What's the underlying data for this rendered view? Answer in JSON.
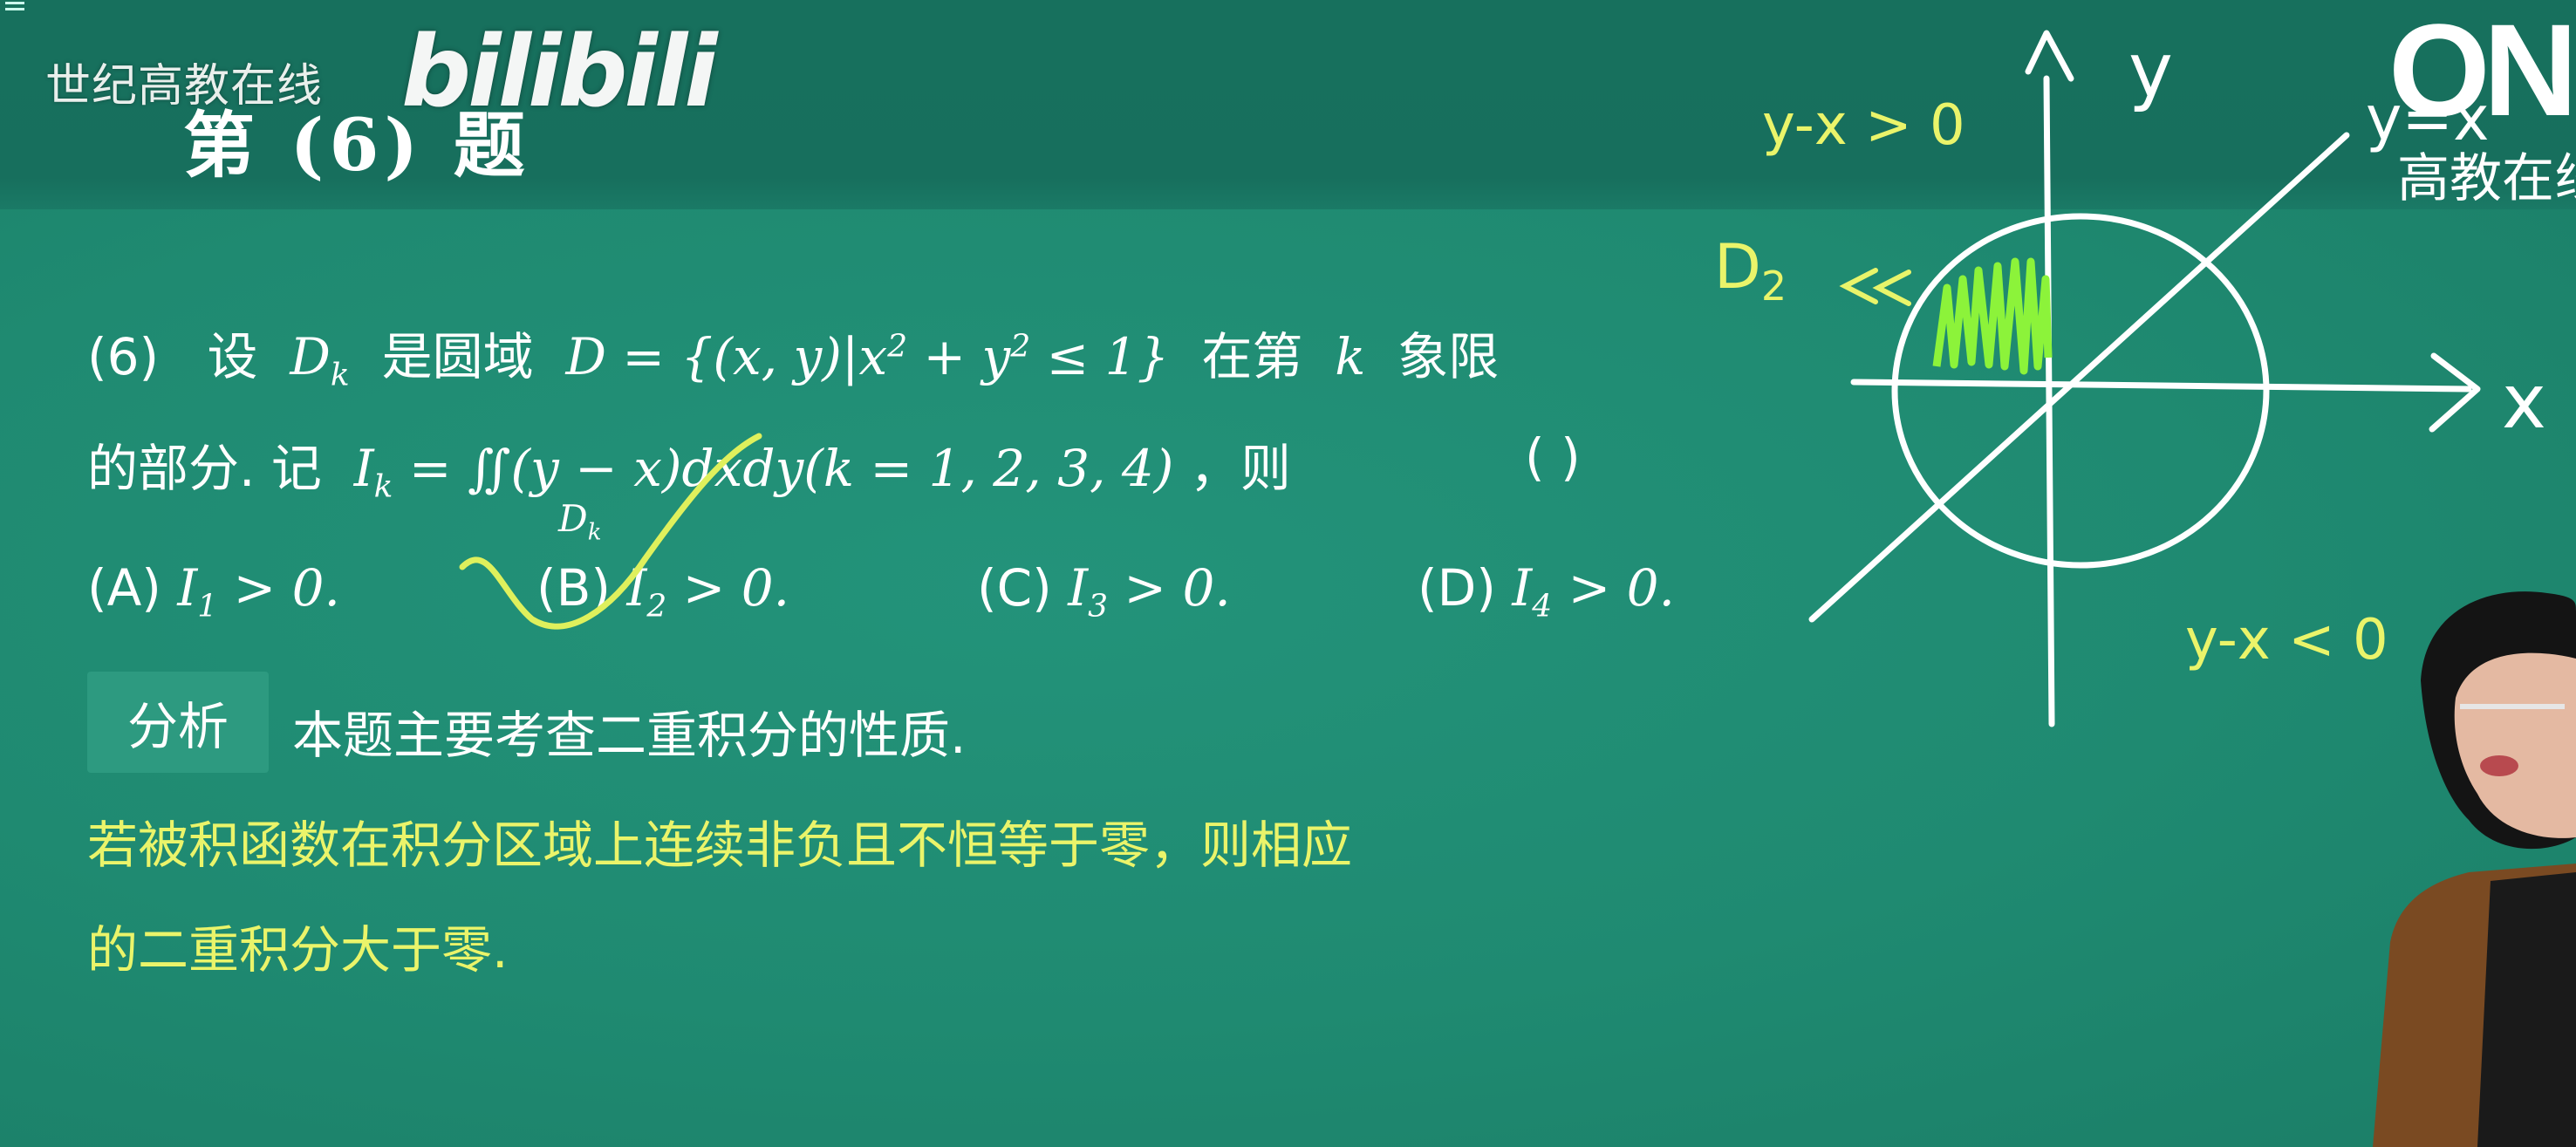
{
  "watermark": {
    "text": "世纪高教在线",
    "logo": "bilibili"
  },
  "title": "第 (6) 题",
  "question": {
    "number": "(6)",
    "line1_a": "设",
    "dk": "D",
    "dk_sub": "k",
    "line1_b": "是圆域",
    "set_expr_a": "D = {(x, y)|x",
    "sup2": "2",
    "set_expr_b": " + y",
    "set_expr_c": " ≤ 1}",
    "line1_c": "在第",
    "k": "k",
    "line1_d": "象限",
    "line2_a": "的部分. 记",
    "ik": "I",
    "ik_sub": "k",
    "eq": " = ∬",
    "integrand": "(y − x)dxdy(k = 1, 2, 3, 4)",
    "line2_b": "，则",
    "paren": "(        )",
    "sub_domain": "D",
    "sub_domain_k": "k"
  },
  "options": [
    {
      "letter": "(A)",
      "var": "I",
      "sub": "1",
      "rel": " > 0."
    },
    {
      "letter": "(B)",
      "var": "I",
      "sub": "2",
      "rel": " > 0."
    },
    {
      "letter": "(C)",
      "var": "I",
      "sub": "3",
      "rel": " > 0."
    },
    {
      "letter": "(D)",
      "var": "I",
      "sub": "4",
      "rel": " > 0."
    }
  ],
  "analysis": {
    "tag": "分析",
    "text": "本题主要考查二重积分的性质."
  },
  "highlight": {
    "line1": "若被积函数在积分区域上连续非负且不恒等于零，则相应",
    "line2": "的二重积分大于零."
  },
  "sketch": {
    "y_axis": "y",
    "x_axis": "x",
    "line_label": "y=x",
    "upper": "y-x > 0",
    "lower": "y-x < 0",
    "region": "D",
    "region_sub": "2",
    "arrow": "<<"
  },
  "brand": {
    "big": "ON",
    "small": "高教在线"
  },
  "colors": {
    "board": "#1f8a71",
    "chalk_yellow": "#eaf46a",
    "chalk_green": "#9af53a",
    "chalk_white": "#ffffff"
  }
}
